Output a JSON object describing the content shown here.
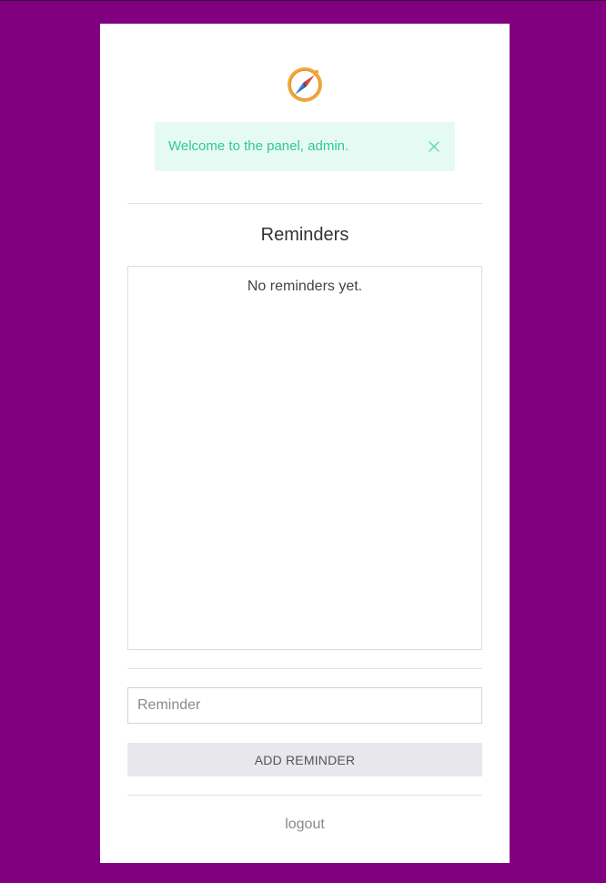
{
  "alert": {
    "message": "Welcome to the panel, admin."
  },
  "reminders": {
    "heading": "Reminders",
    "empty_text": "No reminders yet.",
    "input_placeholder": "Reminder",
    "input_value": "",
    "add_label": "ADD REMINDER"
  },
  "footer": {
    "logout_label": "logout"
  },
  "icons": {
    "logo": "compass-icon",
    "close": "close-icon"
  },
  "colors": {
    "background": "#800080",
    "card": "#ffffff",
    "alert_bg": "#e6faf4",
    "alert_text": "#2fc89a"
  }
}
